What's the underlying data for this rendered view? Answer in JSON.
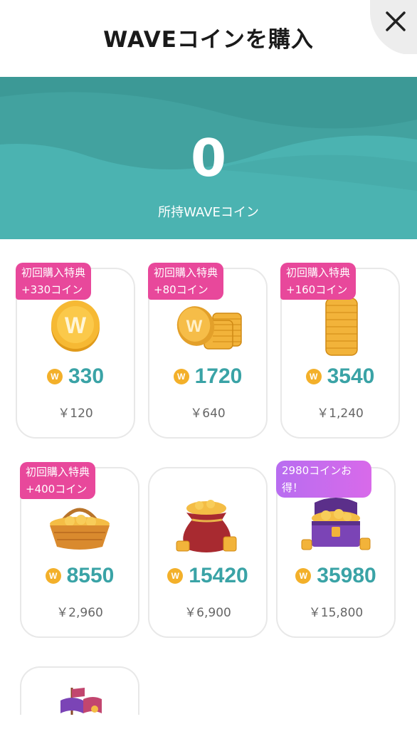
{
  "header": {
    "title": "WAVEコインを購入",
    "close_icon": "close-icon"
  },
  "hero": {
    "balance": "0",
    "label": "所持WAVEコイン"
  },
  "products": [
    {
      "coins": "330",
      "price": "￥120",
      "badge_line1": "初回購入特典",
      "badge_line2": "+330コイン",
      "art": "single-coin"
    },
    {
      "coins": "1720",
      "price": "￥640",
      "badge_line1": "初回購入特典",
      "badge_line2": "+80コイン",
      "art": "coin-stacks"
    },
    {
      "coins": "3540",
      "price": "￥1,240",
      "badge_line1": "初回購入特典",
      "badge_line2": "+160コイン",
      "art": "tall-coin-stack"
    },
    {
      "coins": "8550",
      "price": "￥2,960",
      "badge_line1": "初回購入特典",
      "badge_line2": "+400コイン",
      "art": "coin-basket"
    },
    {
      "coins": "15420",
      "price": "￥6,900",
      "art": "coin-sack"
    },
    {
      "coins": "35980",
      "price": "￥15,800",
      "badge_text": "2980コインお得！",
      "art": "treasure-chest"
    },
    {
      "art": "treasure-ship"
    }
  ],
  "coin_glyph": "W",
  "colors": {
    "accent_teal": "#3aa3a6",
    "hero_bg": "#4bb3b1",
    "badge_pink": "#e8489b",
    "badge_purple": "#c56bee",
    "coin_gold": "#f3b02a"
  }
}
